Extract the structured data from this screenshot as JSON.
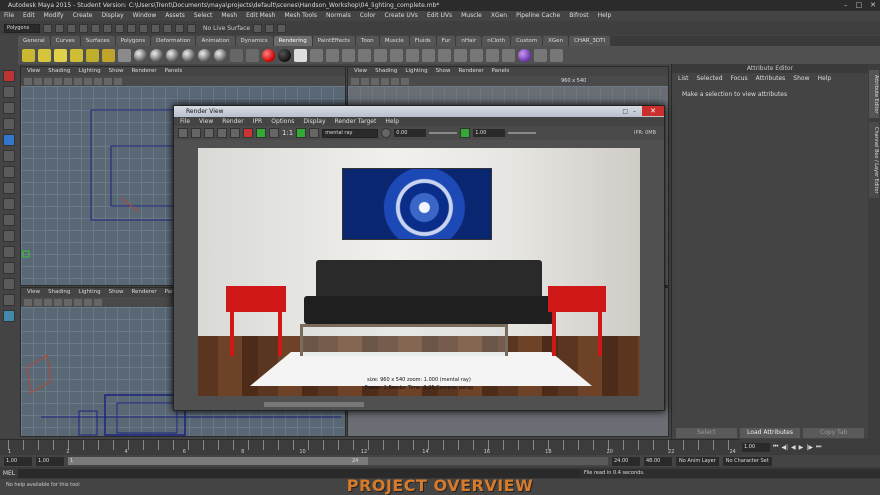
{
  "app": {
    "title": "Autodesk Maya 2015 - Student Version: C:\\Users\\Trent\\Documents\\maya\\projects\\default\\scenes\\Handson_Workshop\\04_lighting_complete.mb*"
  },
  "window_controls": [
    "–",
    "□",
    "✕"
  ],
  "menubar": [
    "File",
    "Edit",
    "Modify",
    "Create",
    "Display",
    "Window",
    "Assets",
    "Select",
    "Mesh",
    "Edit Mesh",
    "Mesh Tools",
    "Normals",
    "Color",
    "Create UVs",
    "Edit UVs",
    "Muscle",
    "XGen",
    "Pipeline Cache",
    "Bifrost",
    "Help"
  ],
  "statusline": {
    "mode": "Polygons",
    "live_surface": "No Live Surface"
  },
  "shelf_tabs": [
    "General",
    "Curves",
    "Surfaces",
    "Polygons",
    "Deformation",
    "Animation",
    "Dynamics",
    "Rendering",
    "PaintEffects",
    "Toon",
    "Muscle",
    "Fluids",
    "Fur",
    "nHair",
    "nCloth",
    "Custom",
    "XGen",
    "CHAR_3DTI"
  ],
  "active_shelf_tab": "Rendering",
  "viewport_menu": [
    "View",
    "Shading",
    "Lighting",
    "Show",
    "Renderer",
    "Panels"
  ],
  "viewport_label_top_right": "960 x 540",
  "attribute_editor": {
    "title": "Attribute Editor",
    "menu": [
      "List",
      "Selected",
      "Focus",
      "Attributes",
      "Show",
      "Help"
    ],
    "message": "Make a selection to view attributes",
    "buttons": [
      "Select",
      "Load Attributes",
      "Copy Tab"
    ],
    "side_tabs": [
      "Attribute Editor",
      "Channel Box / Layer Editor"
    ]
  },
  "render_view": {
    "title": "Render View",
    "menu": [
      "File",
      "View",
      "Render",
      "IPR",
      "Options",
      "Display",
      "Render Target",
      "Help"
    ],
    "one_to_one": "1:1",
    "renderer": "mental ray",
    "exposure": "0.00",
    "gamma": "1.00",
    "ipr_label": "IPR: 0MB",
    "info_line1": "size: 960 x 540  zoom: 1.000          (mental ray)",
    "info_line2": "Frame: 1     Render Time: 3:25     Camera: persp"
  },
  "time_slider": {
    "tick_labels": [
      "1",
      "2",
      "4",
      "6",
      "8",
      "10",
      "12",
      "14",
      "16",
      "18",
      "20",
      "22",
      "24"
    ],
    "current_frame": "1.00"
  },
  "range_slider": {
    "start": "1.00",
    "playback_start": "1.00",
    "playback_end": "24.00",
    "end": "48.00",
    "inner_left": "1",
    "inner_right": "24",
    "anim_layer": "No Anim Layer",
    "character_set": "No Character Set"
  },
  "command_line": {
    "label": "MEL",
    "result": "File read in  0.4 seconds."
  },
  "help_line": "No help available for this tool",
  "overlay_caption": "PROJECT OVERVIEW"
}
